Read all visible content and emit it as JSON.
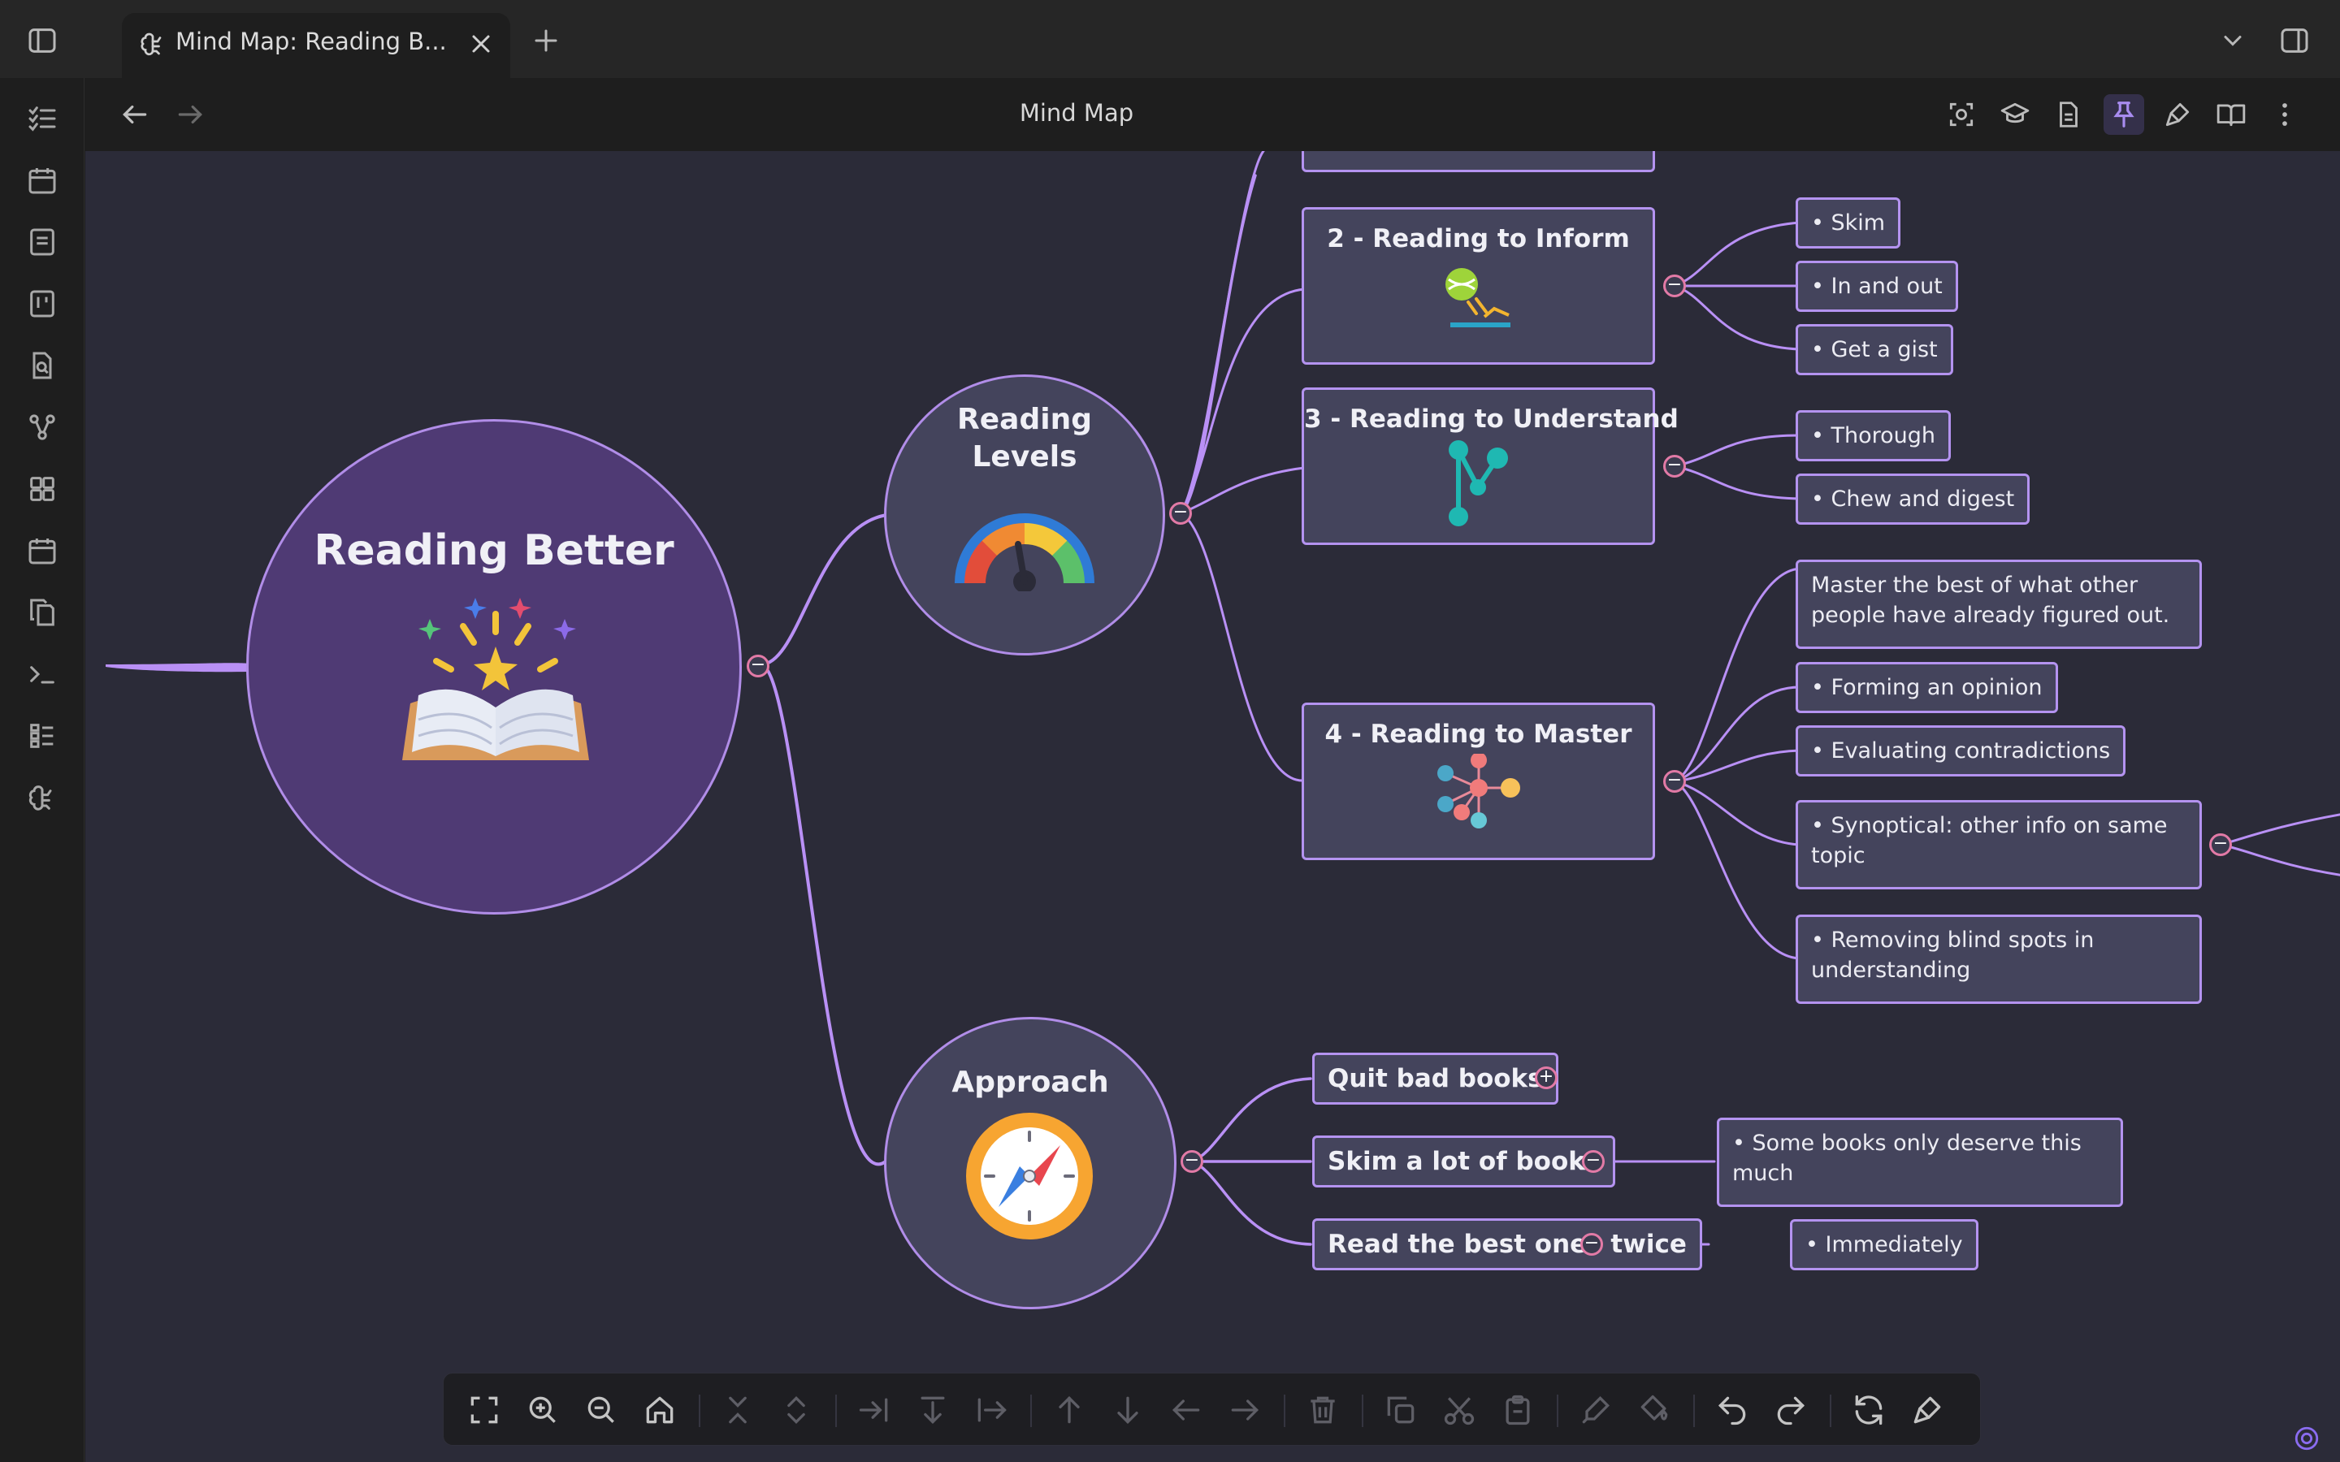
{
  "tab": {
    "title": "Mind Map: Reading B..."
  },
  "nav": {
    "title": "Mind Map"
  },
  "map": {
    "root": {
      "title": "Reading Better"
    },
    "levels": {
      "title": "Reading Levels",
      "line1": "Reading",
      "line2": "Levels",
      "items": [
        {
          "title": "2 - Reading to Inform",
          "leaves": [
            "• Skim",
            "• In and out",
            "• Get a gist"
          ]
        },
        {
          "title": "3 - Reading to Understand",
          "leaves": [
            "• Thorough",
            "• Chew and digest"
          ]
        },
        {
          "title": "4 - Reading to Master",
          "leaves": [
            "Master the best of what other people have already figured out.",
            "• Forming an opinion",
            "• Evaluating contradictions",
            "• Synoptical: other info on same topic",
            "• Removing blind spots in understanding"
          ]
        }
      ]
    },
    "approach": {
      "title": "Approach",
      "items": [
        {
          "title": "Quit bad books"
        },
        {
          "title": "Skim a lot of books",
          "leaf": "• Some books only deserve this much"
        },
        {
          "title": "Read the best ones twice",
          "leaf": "• Immediately"
        }
      ]
    }
  },
  "colors": {
    "accent": "#b493f0",
    "node": "#44445c",
    "canvas": "#2b2b38",
    "root": "#4f3a74",
    "toggle": "#e27aa6"
  }
}
